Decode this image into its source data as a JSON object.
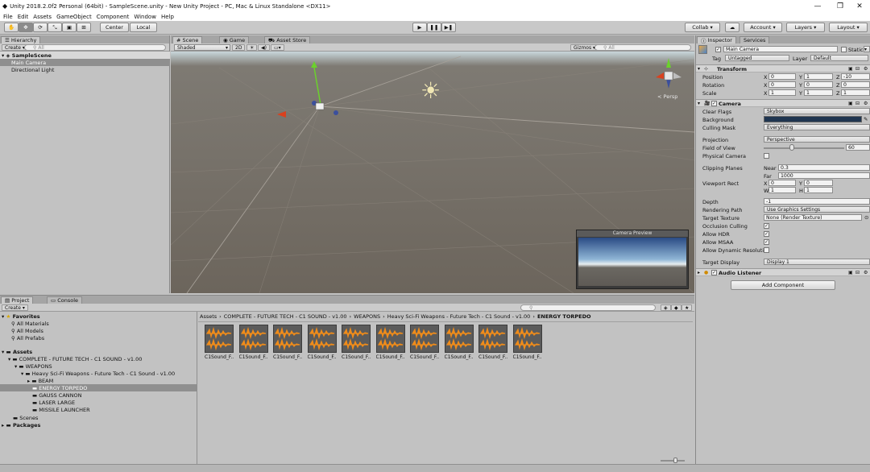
{
  "window": {
    "title": "Unity 2018.2.0f2 Personal (64bit) - SampleScene.unity - New Unity Project - PC, Mac & Linux Standalone <DX11>",
    "controls": [
      "—",
      "❐",
      "✕"
    ]
  },
  "menu": [
    "File",
    "Edit",
    "Assets",
    "GameObject",
    "Component",
    "Window",
    "Help"
  ],
  "toolbar": {
    "pivot_center": "Center",
    "pivot_local": "Local",
    "collab": "Collab ▾",
    "account": "Account",
    "layers": "Layers",
    "layout": "Layout"
  },
  "hierarchy": {
    "tab": "Hierarchy",
    "create": "Create ▾",
    "search_placeholder": "All",
    "scene": "SampleScene",
    "items": [
      "Main Camera",
      "Directional Light"
    ]
  },
  "scene_view": {
    "tabs": [
      "Scene",
      "Game",
      "Asset Store"
    ],
    "shading": "Shaded",
    "mode_2d": "2D",
    "gizmos": "Gizmos ▾",
    "search_placeholder": "All",
    "persp_label": "< Persp",
    "camera_preview_title": "Camera Preview"
  },
  "inspector": {
    "tabs": [
      "Inspector",
      "Services"
    ],
    "object_name": "Main Camera",
    "static_label": "Static",
    "tag_label": "Tag",
    "tag_value": "Untagged",
    "layer_label": "Layer",
    "layer_value": "Default",
    "transform": {
      "title": "Transform",
      "position_label": "Position",
      "rotation_label": "Rotation",
      "scale_label": "Scale",
      "axis_labels": [
        "X",
        "Y",
        "Z"
      ],
      "position": [
        "0",
        "1",
        "-10"
      ],
      "rotation": [
        "0",
        "0",
        "0"
      ],
      "scale": [
        "1",
        "1",
        "1"
      ]
    },
    "camera": {
      "title": "Camera",
      "clear_flags_label": "Clear Flags",
      "clear_flags": "Skybox",
      "background_label": "Background",
      "background_color": "#1f3550",
      "culling_mask_label": "Culling Mask",
      "culling_mask": "Everything",
      "projection_label": "Projection",
      "projection": "Perspective",
      "fov_label": "Field of View",
      "fov": "60",
      "fov_fraction": 0.35,
      "physical_camera_label": "Physical Camera",
      "clipping_label": "Clipping Planes",
      "near_label": "Near",
      "near": "0.3",
      "far_label": "Far",
      "far": "1000",
      "viewport_label": "Viewport Rect",
      "vx_label": "X",
      "vx": "0",
      "vy_label": "Y",
      "vy": "0",
      "vw_label": "W",
      "vw": "1",
      "vh_label": "H",
      "vh": "1",
      "depth_label": "Depth",
      "depth": "-1",
      "rendering_path_label": "Rendering Path",
      "rendering_path": "Use Graphics Settings",
      "target_texture_label": "Target Texture",
      "target_texture": "None (Render Texture)",
      "occlusion_label": "Occlusion Culling",
      "hdr_label": "Allow HDR",
      "msaa_label": "Allow MSAA",
      "dynamic_res_label": "Allow Dynamic Resoluti",
      "target_display_label": "Target Display",
      "target_display": "Display 1"
    },
    "audio_listener": "Audio Listener",
    "add_component": "Add Component"
  },
  "project": {
    "tabs": [
      "Project",
      "Console"
    ],
    "create": "Create ▾",
    "favorites": "Favorites",
    "favorite_items": [
      "All Materials",
      "All Models",
      "All Prefabs"
    ],
    "assets_root": "Assets",
    "tree": [
      "COMPLETE - FUTURE TECH - C1 SOUND - v1.00",
      "WEAPONS",
      "Heavy Sci-Fi Weapons - Future Tech - C1 Sound - v1.00",
      "BEAM",
      "ENERGY TORPEDO",
      "GAUSS CANNON",
      "LASER LARGE",
      "MISSILE LAUNCHER"
    ],
    "scenes": "Scenes",
    "packages": "Packages",
    "breadcrumb": [
      "Assets",
      "COMPLETE - FUTURE TECH - C1 SOUND - v1.00",
      "WEAPONS",
      "Heavy Sci-Fi Weapons - Future Tech - C1 Sound - v1.00",
      "ENERGY TORPEDO"
    ],
    "breadcrumb_sep": "›",
    "assets": [
      "C1Sound_F...",
      "C1Sound_F...",
      "C1Sound_F...",
      "C1Sound_F...",
      "C1Sound_F...",
      "C1Sound_F...",
      "C1Sound_F...",
      "C1Sound_F...",
      "C1Sound_F...",
      "C1Sound_F..."
    ],
    "waveform_color": "#f08c1a"
  }
}
